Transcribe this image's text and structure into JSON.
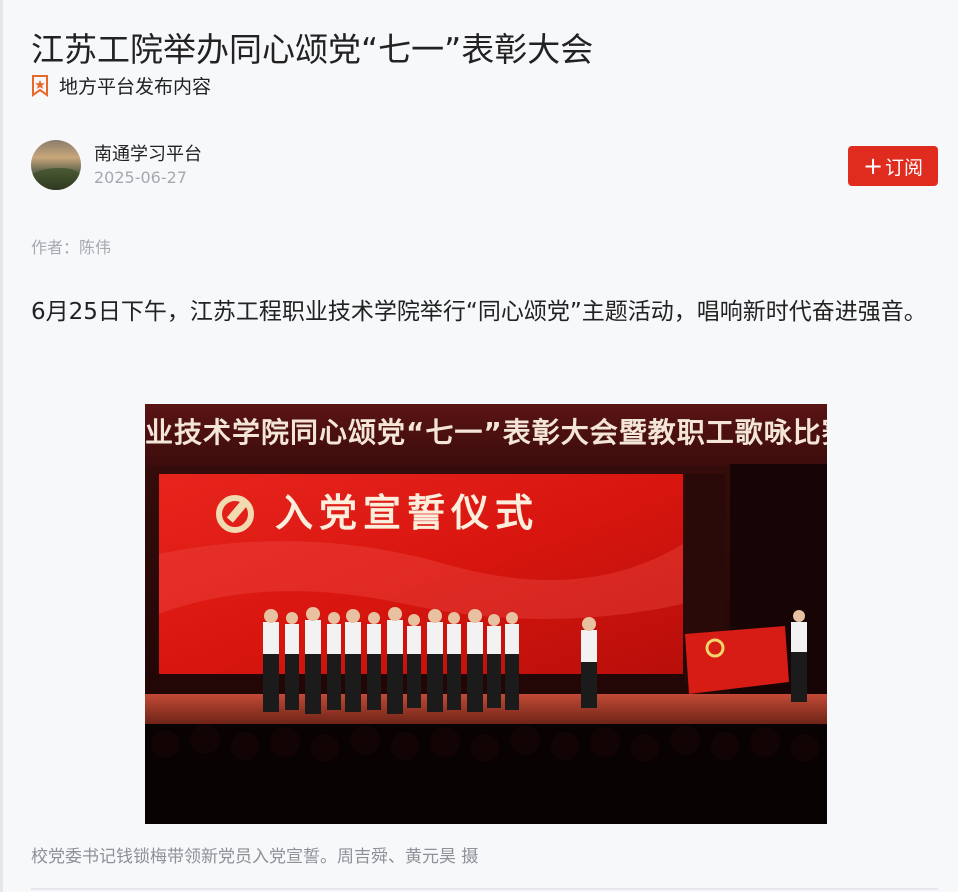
{
  "article": {
    "title": "江苏工院举办同心颂党“七一”表彰大会",
    "source_label": "地方平台发布内容",
    "account_name": "南通学习平台",
    "publish_date": "2025-06-27",
    "subscribe_label": "订阅",
    "subscribe_plus": "+",
    "author": "作者：陈伟",
    "lead": "6月25日下午，江苏工程职业技术学院举行“同心颂党”主题活动，唱响新时代奋进强音。",
    "photo": {
      "banner_text": "业技术学院同心颂党“七一”表彰大会暨教职工歌咏比赛",
      "screen_text": "入党宣誓仪式"
    },
    "caption": "校党委书记钱锁梅带领新党员入党宣誓。周吉舜、黄元昊 摄"
  },
  "colors": {
    "accent_red": "#e02b1f",
    "muted_text": "#a4a9b1",
    "background": "#f7f8fa"
  },
  "icons": {
    "source": "bookmark-star-icon"
  }
}
